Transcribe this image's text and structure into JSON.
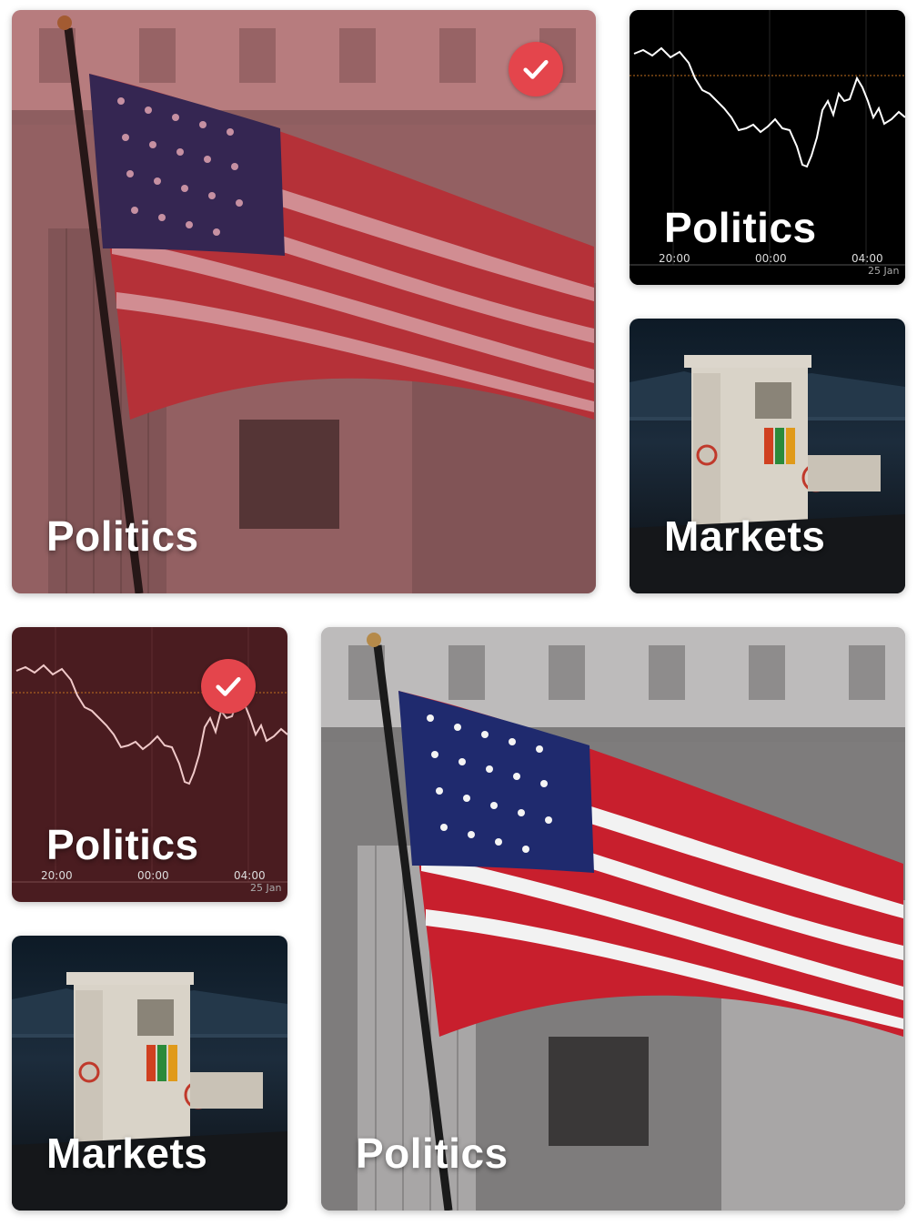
{
  "colors": {
    "accent": "#e4454c",
    "chart_bg": "#000000",
    "chart_bg_selected": "#4a1c20"
  },
  "cards": [
    {
      "label": "Politics",
      "image": "flag-building",
      "selected": true
    },
    {
      "label": "Politics",
      "image": "market-chart",
      "selected": false,
      "ticks": [
        "20:00",
        "00:00",
        "04:00"
      ],
      "date": "25 Jan"
    },
    {
      "label": "Markets",
      "image": "fuel-pump",
      "selected": false
    },
    {
      "label": "Politics",
      "image": "market-chart",
      "selected": true,
      "ticks": [
        "20:00",
        "00:00",
        "04:00"
      ],
      "date": "25 Jan"
    },
    {
      "label": "Markets",
      "image": "fuel-pump",
      "selected": false
    },
    {
      "label": "Politics",
      "image": "flag-building",
      "selected": false
    }
  ]
}
